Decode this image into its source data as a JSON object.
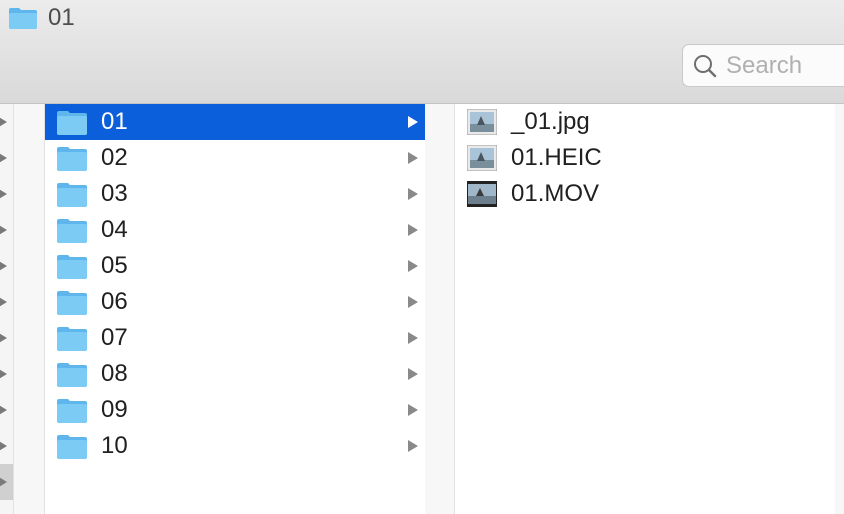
{
  "window": {
    "title": "01"
  },
  "search": {
    "placeholder": "Search"
  },
  "colors": {
    "selection": "#0b5fdb",
    "folder": "#6cc3f2",
    "toolbar": "#e3e3e3"
  },
  "folders": [
    {
      "label": "01",
      "selected": true
    },
    {
      "label": "02"
    },
    {
      "label": "03"
    },
    {
      "label": "04"
    },
    {
      "label": "05"
    },
    {
      "label": "06"
    },
    {
      "label": "07"
    },
    {
      "label": "08"
    },
    {
      "label": "09"
    },
    {
      "label": "10"
    }
  ],
  "files": [
    {
      "label": "_01.jpg",
      "icon": "image-file-icon"
    },
    {
      "label": "01.HEIC",
      "icon": "image-file-icon"
    },
    {
      "label": "01.MOV",
      "icon": "video-file-icon"
    }
  ]
}
